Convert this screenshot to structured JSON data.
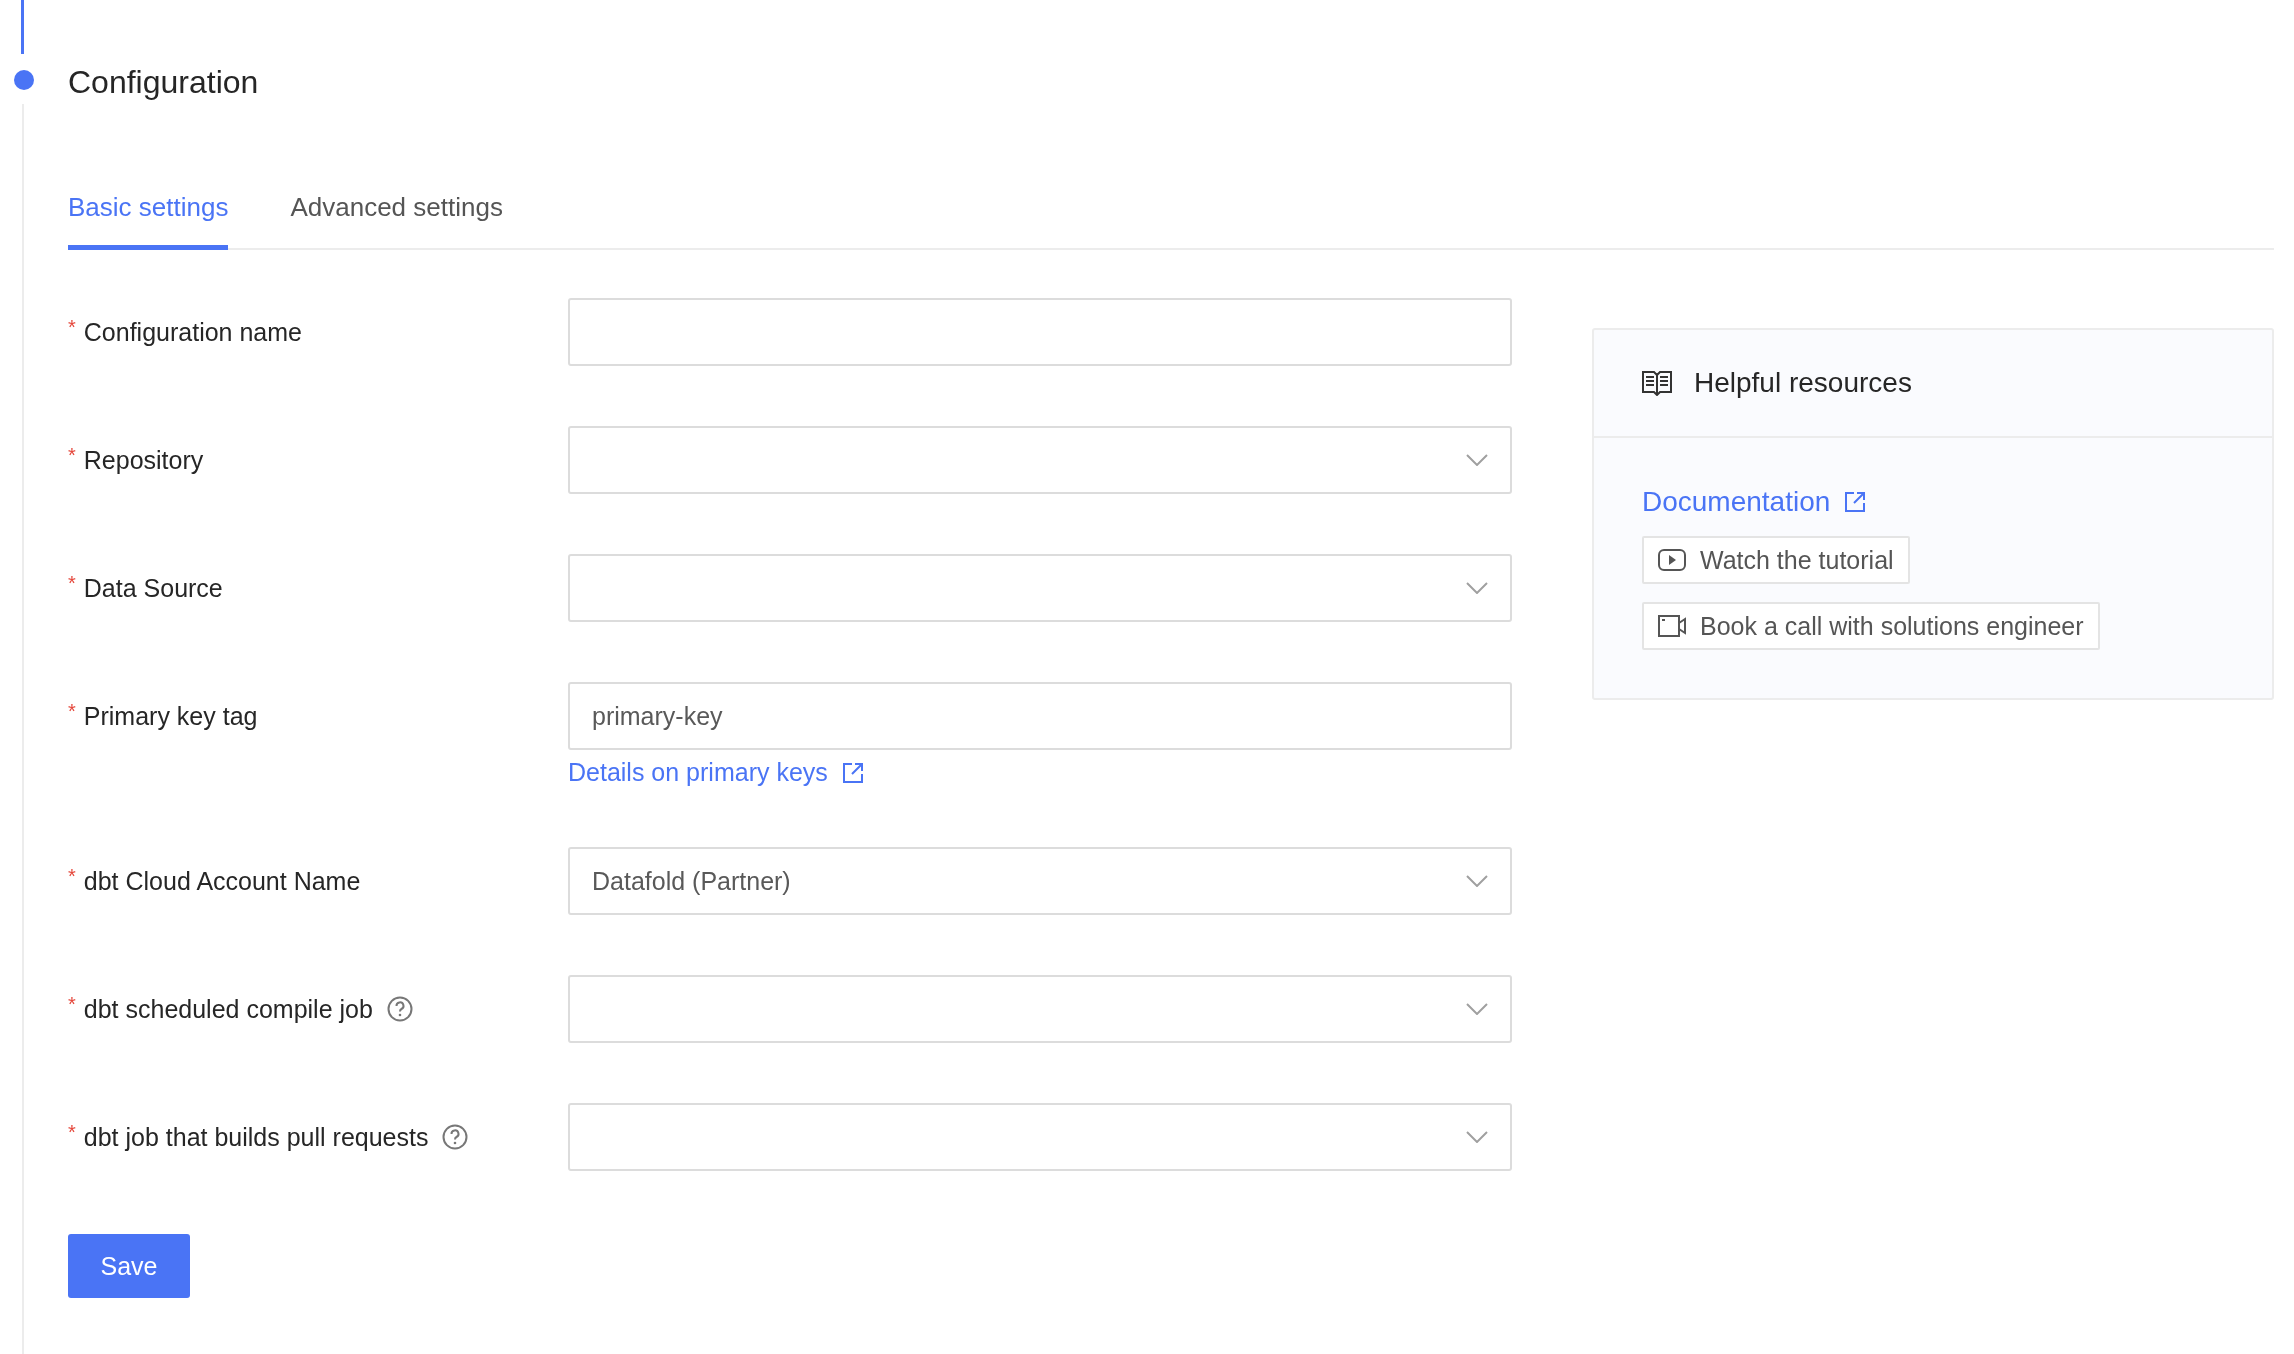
{
  "step": {
    "title": "Configuration",
    "active": true
  },
  "tabs": [
    {
      "label": "Basic settings",
      "selected": true
    },
    {
      "label": "Advanced settings",
      "selected": false
    }
  ],
  "fields": [
    {
      "required_mark": "*",
      "label": "Configuration name",
      "kind": "text",
      "help": false
    },
    {
      "required_mark": "*",
      "label": "Repository",
      "kind": "select",
      "help": false
    },
    {
      "required_mark": "*",
      "label": "Data Source",
      "kind": "select",
      "help": false
    },
    {
      "required_mark": "*",
      "label": "Primary key tag",
      "kind": "text",
      "help": false,
      "value": "primary-key",
      "link": "Details on primary keys"
    },
    {
      "required_mark": "*",
      "label": "dbt Cloud Account Name",
      "kind": "select",
      "help": false,
      "value": "Datafold (Partner)"
    },
    {
      "required_mark": "*",
      "label": "dbt scheduled compile job",
      "kind": "select",
      "help": true
    },
    {
      "required_mark": "*",
      "label": "dbt job that builds pull requests",
      "kind": "select",
      "help": true
    }
  ],
  "save_button": "Save",
  "resources": {
    "title": "Helpful resources",
    "link": "Documentation",
    "buttons": [
      {
        "kind": "video",
        "label": "Watch the tutorial"
      },
      {
        "kind": "call",
        "label": "Book a call with solutions engineer"
      }
    ]
  }
}
